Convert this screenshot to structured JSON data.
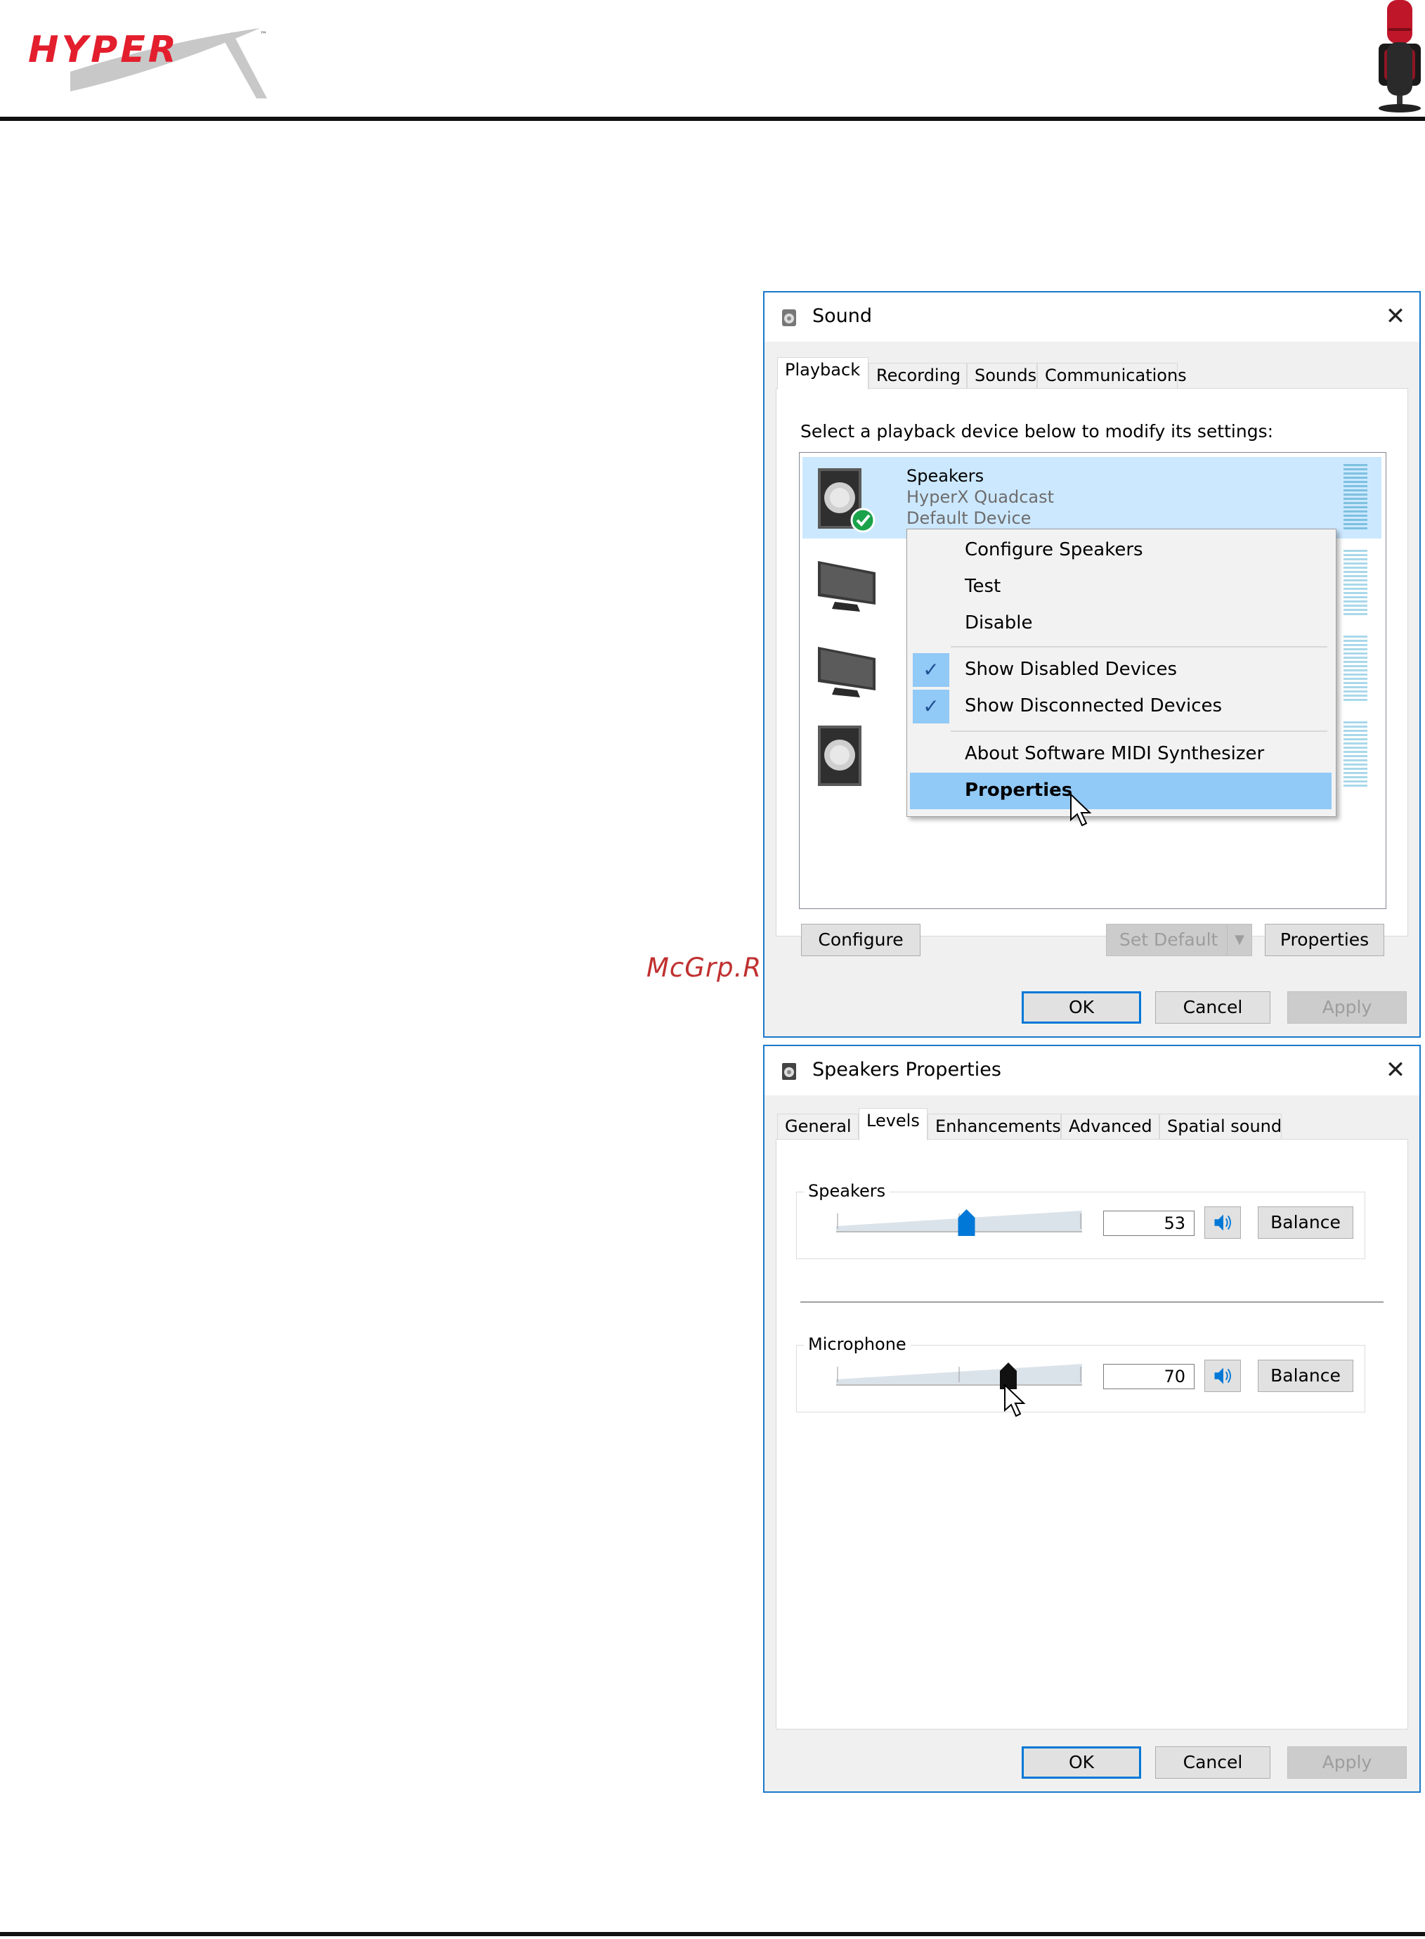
{
  "brand": {
    "logo_text": "HYPERX",
    "watermark": "McGrp.Ru"
  },
  "colors": {
    "accent": "#0078d7",
    "selection": "#cce8ff",
    "menu_highlight": "#91c9f7",
    "brand_red": "#e31e2d"
  },
  "sound_dialog": {
    "title": "Sound",
    "tabs": [
      "Playback",
      "Recording",
      "Sounds",
      "Communications"
    ],
    "active_tab": "Playback",
    "instruction": "Select a playback device below to modify its settings:",
    "devices": [
      {
        "name": "Speakers",
        "model": "HyperX Quadcast",
        "status": "Default Device",
        "icon": "speaker-icon",
        "selected": true
      },
      {
        "icon": "monitor-icon"
      },
      {
        "icon": "monitor-icon"
      },
      {
        "icon": "speaker-icon"
      }
    ],
    "context_menu": {
      "items": [
        {
          "label": "Configure Speakers"
        },
        {
          "label": "Test"
        },
        {
          "label": "Disable"
        },
        {
          "label": "Show Disabled Devices",
          "checked": true
        },
        {
          "label": "Show Disconnected Devices",
          "checked": true
        },
        {
          "label": "About Software MIDI Synthesizer"
        },
        {
          "label": "Properties",
          "highlighted": true
        }
      ]
    },
    "buttons": {
      "configure": "Configure",
      "set_default": "Set Default",
      "properties": "Properties",
      "ok": "OK",
      "cancel": "Cancel",
      "apply": "Apply"
    }
  },
  "properties_dialog": {
    "title": "Speakers Properties",
    "tabs": [
      "General",
      "Levels",
      "Enhancements",
      "Advanced",
      "Spatial sound"
    ],
    "active_tab": "Levels",
    "speakers": {
      "label": "Speakers",
      "value": "53",
      "level": 53,
      "balance": "Balance"
    },
    "microphone": {
      "label": "Microphone",
      "value": "70",
      "level": 70,
      "balance": "Balance"
    },
    "buttons": {
      "ok": "OK",
      "cancel": "Cancel",
      "apply": "Apply"
    }
  }
}
